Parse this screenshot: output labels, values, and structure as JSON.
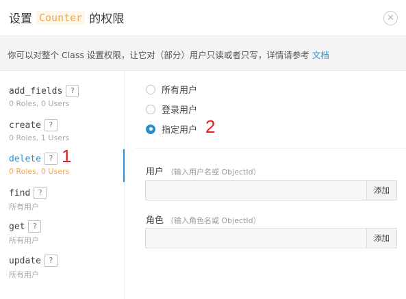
{
  "dialog": {
    "title_prefix": "设置",
    "class_name": "Counter",
    "title_suffix": "的权限",
    "close_glyph": "✕"
  },
  "info": {
    "text": "你可以对整个 Class 设置权限，让它对（部分）用户只读或者只写，详情请参考",
    "link": "文档"
  },
  "operations": [
    {
      "name": "add_fields",
      "help": "?",
      "summary": "0 Roles, 0 Users"
    },
    {
      "name": "create",
      "help": "?",
      "summary": "0 Roles, 1 Users"
    },
    {
      "name": "delete",
      "help": "?",
      "summary": "0 Roles, 0 Users",
      "active": true
    },
    {
      "name": "find",
      "help": "?",
      "summary": "所有用户"
    },
    {
      "name": "get",
      "help": "?",
      "summary": "所有用户"
    },
    {
      "name": "update",
      "help": "?",
      "summary": "所有用户"
    }
  ],
  "access": {
    "options": [
      {
        "label": "所有用户",
        "checked": false
      },
      {
        "label": "登录用户",
        "checked": false
      },
      {
        "label": "指定用户",
        "checked": true
      }
    ]
  },
  "users_field": {
    "label": "用户",
    "hint": "（输入用户名或 ObjectId）",
    "value": "",
    "add_label": "添加"
  },
  "roles_field": {
    "label": "角色",
    "hint": "（输入角色名或 ObjectId）",
    "value": "",
    "add_label": "添加"
  },
  "annotations": {
    "first": "1",
    "second": "2"
  },
  "colors": {
    "accent": "#2a8fd0",
    "warning": "#f0a64a",
    "annotation": "#e02020"
  }
}
